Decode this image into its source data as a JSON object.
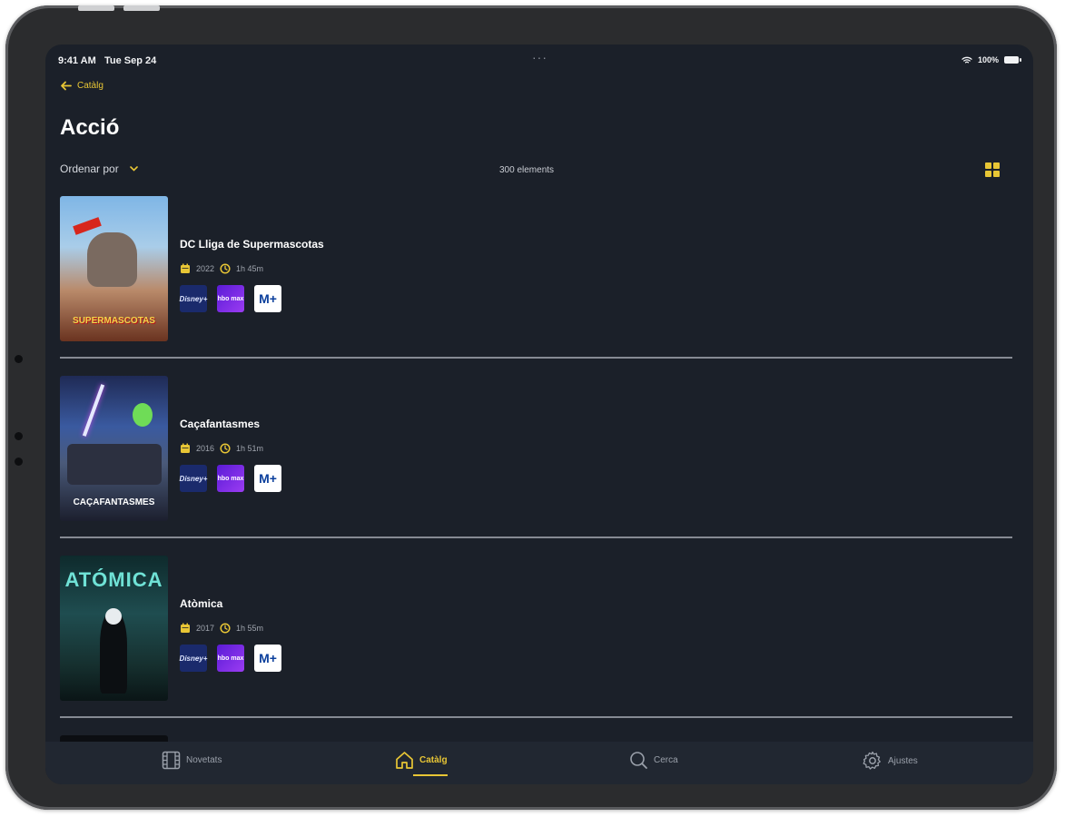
{
  "status_bar": {
    "time": "9:41 AM",
    "date": "Tue Sep 24",
    "multitask": "···",
    "battery": "100%"
  },
  "nav": {
    "back_label": "Catàlg"
  },
  "page": {
    "title": "Acció",
    "sort_label": "Ordenar por",
    "count": "300 elements"
  },
  "colors": {
    "accent": "#e8c635",
    "background": "#1b2029",
    "tabbar": "#212731"
  },
  "movies": [
    {
      "title": "DC Lliga de Supermascotas",
      "year": "2022",
      "duration": "1h 45m",
      "poster_text": "SUPERMASCOTAS",
      "providers": [
        {
          "name": "Disney+",
          "label": "Disney+"
        },
        {
          "name": "HBO Max",
          "label": "hbo max"
        },
        {
          "name": "Movistar+",
          "label": "M+"
        }
      ]
    },
    {
      "title": "Caçafantasmes",
      "year": "2016",
      "duration": "1h 51m",
      "poster_text": "CAÇAFANTASMES",
      "providers": [
        {
          "name": "Disney+",
          "label": "Disney+"
        },
        {
          "name": "HBO Max",
          "label": "hbo max"
        },
        {
          "name": "Movistar+",
          "label": "M+"
        }
      ]
    },
    {
      "title": "Atòmica",
      "year": "2017",
      "duration": "1h 55m",
      "poster_text": "ATÓMICA",
      "providers": [
        {
          "name": "Disney+",
          "label": "Disney+"
        },
        {
          "name": "HBO Max",
          "label": "hbo max"
        },
        {
          "name": "Movistar+",
          "label": "M+"
        }
      ]
    }
  ],
  "tabs": [
    {
      "label": "Novetats",
      "icon": "film-icon"
    },
    {
      "label": "Catàlg",
      "icon": "home-icon"
    },
    {
      "label": "Cerca",
      "icon": "search-icon"
    },
    {
      "label": "Ajustes",
      "icon": "gear-icon"
    }
  ]
}
